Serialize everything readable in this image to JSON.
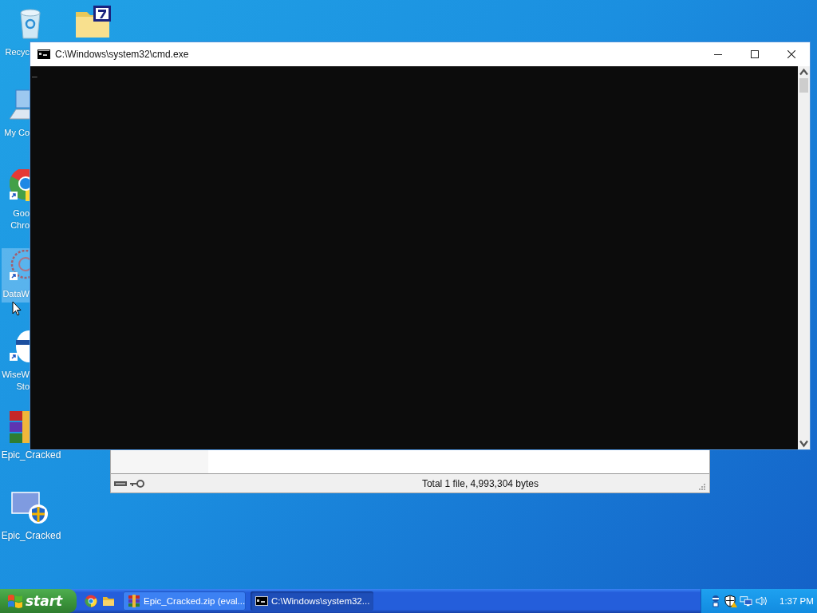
{
  "desktop_icons": [
    {
      "kind": "partial",
      "lines": [
        "Recyc"
      ],
      "selected": false
    },
    {
      "kind": "partial",
      "lines": [
        "My Co"
      ],
      "selected": false
    },
    {
      "kind": "partial",
      "lines": [
        "Goo",
        "Chro"
      ],
      "selected": false
    },
    {
      "kind": "partial",
      "lines": [
        "DataW"
      ],
      "selected": true
    },
    {
      "kind": "partial",
      "lines": [
        "WiseW",
        "Sto"
      ],
      "selected": false
    },
    {
      "kind": "full",
      "lines": [
        "Epic_Cracked"
      ],
      "selected": false
    },
    {
      "kind": "full",
      "lines": [
        "Epic_Cracked"
      ],
      "selected": false
    }
  ],
  "archive_window": {
    "status_text": "Total 1 file, 4,993,304 bytes"
  },
  "console_window": {
    "title": "C:\\Windows\\system32\\cmd.exe",
    "cursor": "_"
  },
  "taskbar": {
    "start": "start",
    "tasks": [
      {
        "label": "Epic_Cracked.zip (eval...",
        "kind": "archive",
        "selected": false
      },
      {
        "label": "C:\\Windows\\system32...",
        "kind": "console",
        "selected": true
      }
    ],
    "clock": "1:37 PM"
  }
}
